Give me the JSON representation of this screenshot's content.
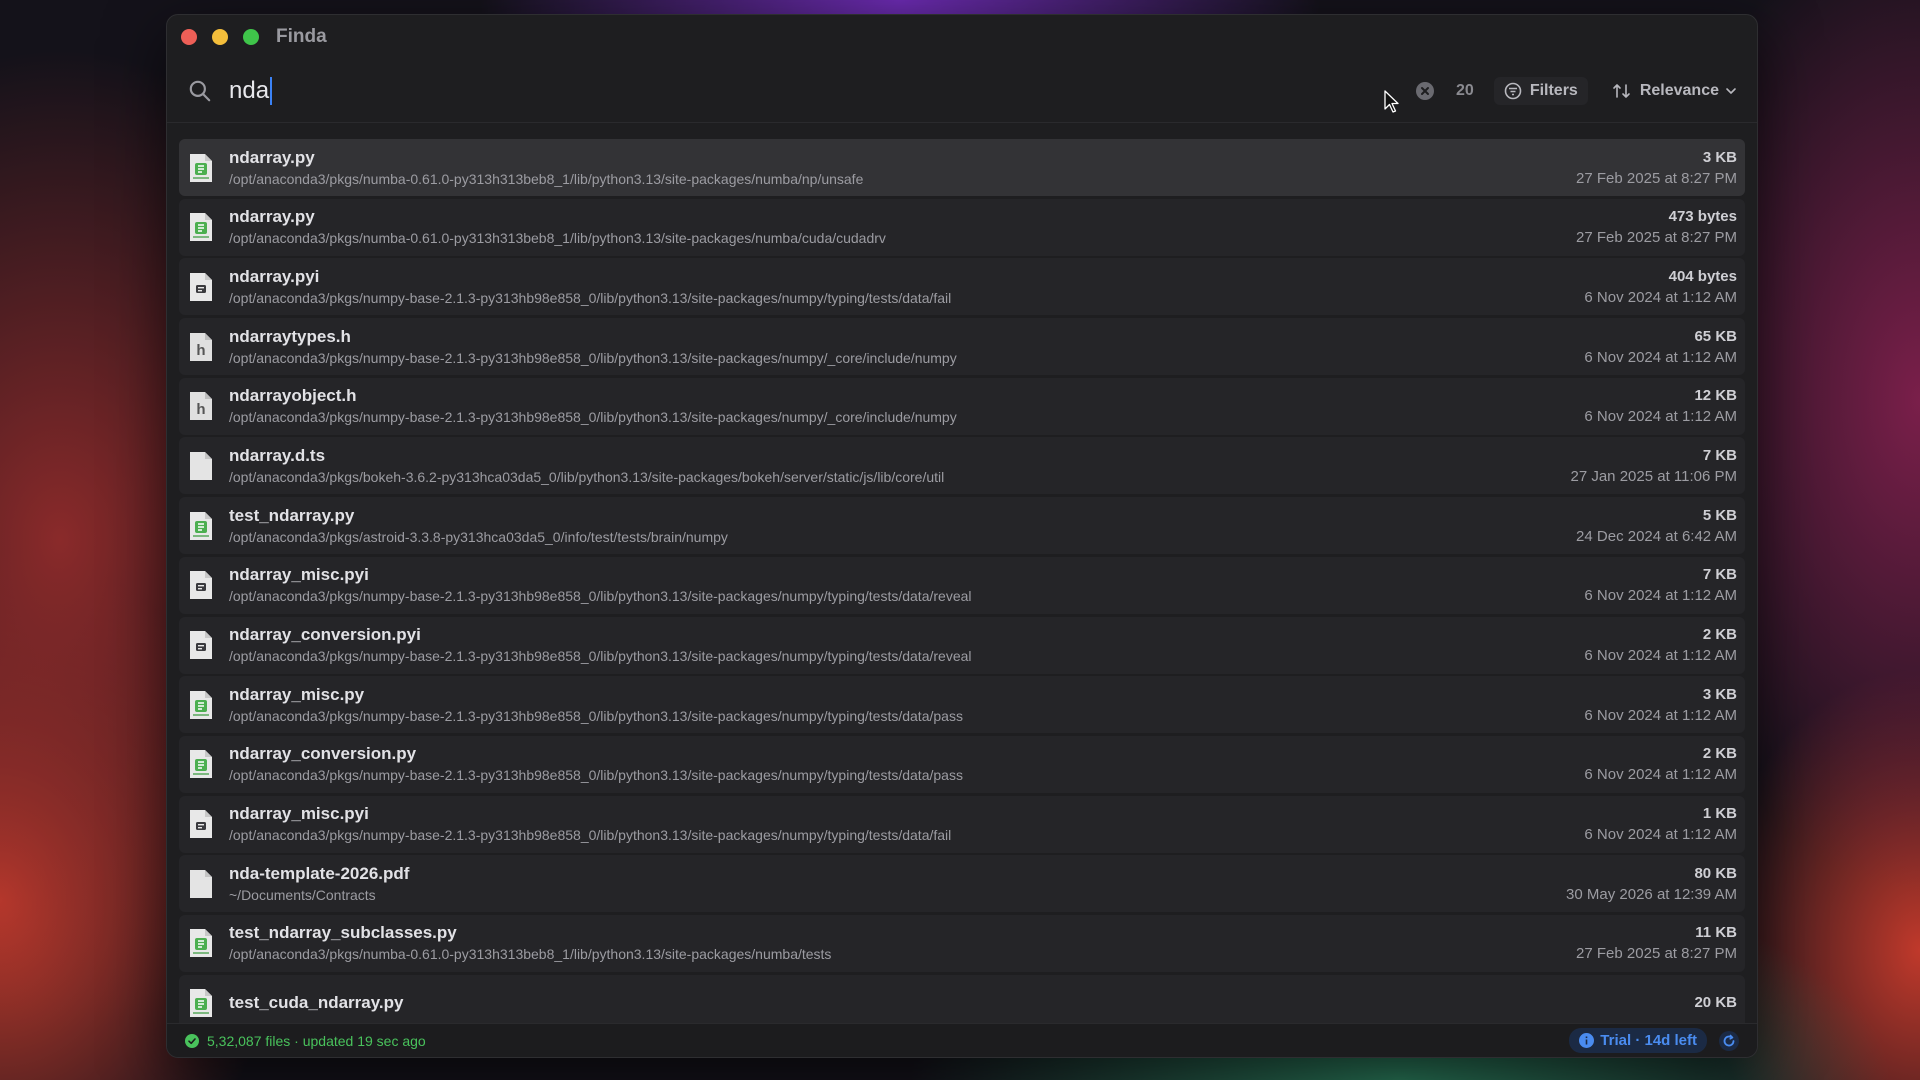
{
  "window": {
    "title": "Finda"
  },
  "search": {
    "query": "nda",
    "result_count": "20"
  },
  "toolbar": {
    "filters_label": "Filters",
    "sort_label": "Relevance"
  },
  "results": [
    {
      "name": "ndarray.py",
      "path": "/opt/anaconda3/pkgs/numba-0.61.0-py313h313beb8_1/lib/python3.13/site-packages/numba/np/unsafe",
      "size": "3 KB",
      "date": "27 Feb 2025 at 8:27 PM",
      "icon": "python-file-icon"
    },
    {
      "name": "ndarray.py",
      "path": "/opt/anaconda3/pkgs/numba-0.61.0-py313h313beb8_1/lib/python3.13/site-packages/numba/cuda/cudadrv",
      "size": "473 bytes",
      "date": "27 Feb 2025 at 8:27 PM",
      "icon": "python-file-icon"
    },
    {
      "name": "ndarray.pyi",
      "path": "/opt/anaconda3/pkgs/numpy-base-2.1.3-py313hb98e858_0/lib/python3.13/site-packages/numpy/typing/tests/data/fail",
      "size": "404 bytes",
      "date": "6 Nov 2024 at 1:12 AM",
      "icon": "stub-file-icon"
    },
    {
      "name": "ndarraytypes.h",
      "path": "/opt/anaconda3/pkgs/numpy-base-2.1.3-py313hb98e858_0/lib/python3.13/site-packages/numpy/_core/include/numpy",
      "size": "65 KB",
      "date": "6 Nov 2024 at 1:12 AM",
      "icon": "header-file-icon"
    },
    {
      "name": "ndarrayobject.h",
      "path": "/opt/anaconda3/pkgs/numpy-base-2.1.3-py313hb98e858_0/lib/python3.13/site-packages/numpy/_core/include/numpy",
      "size": "12 KB",
      "date": "6 Nov 2024 at 1:12 AM",
      "icon": "header-file-icon"
    },
    {
      "name": "ndarray.d.ts",
      "path": "/opt/anaconda3/pkgs/bokeh-3.6.2-py313hca03da5_0/lib/python3.13/site-packages/bokeh/server/static/js/lib/core/util",
      "size": "7 KB",
      "date": "27 Jan 2025 at 11:06 PM",
      "icon": "document-icon"
    },
    {
      "name": "test_ndarray.py",
      "path": "/opt/anaconda3/pkgs/astroid-3.3.8-py313hca03da5_0/info/test/tests/brain/numpy",
      "size": "5 KB",
      "date": "24 Dec 2024 at 6:42 AM",
      "icon": "python-file-icon"
    },
    {
      "name": "ndarray_misc.pyi",
      "path": "/opt/anaconda3/pkgs/numpy-base-2.1.3-py313hb98e858_0/lib/python3.13/site-packages/numpy/typing/tests/data/reveal",
      "size": "7 KB",
      "date": "6 Nov 2024 at 1:12 AM",
      "icon": "stub-file-icon"
    },
    {
      "name": "ndarray_conversion.pyi",
      "path": "/opt/anaconda3/pkgs/numpy-base-2.1.3-py313hb98e858_0/lib/python3.13/site-packages/numpy/typing/tests/data/reveal",
      "size": "2 KB",
      "date": "6 Nov 2024 at 1:12 AM",
      "icon": "stub-file-icon"
    },
    {
      "name": "ndarray_misc.py",
      "path": "/opt/anaconda3/pkgs/numpy-base-2.1.3-py313hb98e858_0/lib/python3.13/site-packages/numpy/typing/tests/data/pass",
      "size": "3 KB",
      "date": "6 Nov 2024 at 1:12 AM",
      "icon": "python-file-icon"
    },
    {
      "name": "ndarray_conversion.py",
      "path": "/opt/anaconda3/pkgs/numpy-base-2.1.3-py313hb98e858_0/lib/python3.13/site-packages/numpy/typing/tests/data/pass",
      "size": "2 KB",
      "date": "6 Nov 2024 at 1:12 AM",
      "icon": "python-file-icon"
    },
    {
      "name": "ndarray_misc.pyi",
      "path": "/opt/anaconda3/pkgs/numpy-base-2.1.3-py313hb98e858_0/lib/python3.13/site-packages/numpy/typing/tests/data/fail",
      "size": "1 KB",
      "date": "6 Nov 2024 at 1:12 AM",
      "icon": "stub-file-icon"
    },
    {
      "name": "nda-template-2026.pdf",
      "path": "~/Documents/Contracts",
      "size": "80 KB",
      "date": "30 May 2026 at 12:39 AM",
      "icon": "document-icon"
    },
    {
      "name": "test_ndarray_subclasses.py",
      "path": "/opt/anaconda3/pkgs/numba-0.61.0-py313h313beb8_1/lib/python3.13/site-packages/numba/tests",
      "size": "11 KB",
      "date": "27 Feb 2025 at 8:27 PM",
      "icon": "python-file-icon"
    },
    {
      "name": "test_cuda_ndarray.py",
      "path": "",
      "size": "20 KB",
      "date": "",
      "icon": "python-file-icon"
    }
  ],
  "status": {
    "text": "5,32,087 files · updated 19 sec ago",
    "trial": "Trial · 14d left"
  },
  "colors": {
    "accent": "#3b82f6",
    "status_ok": "#49c25c",
    "python_icon": "#4caf50"
  }
}
